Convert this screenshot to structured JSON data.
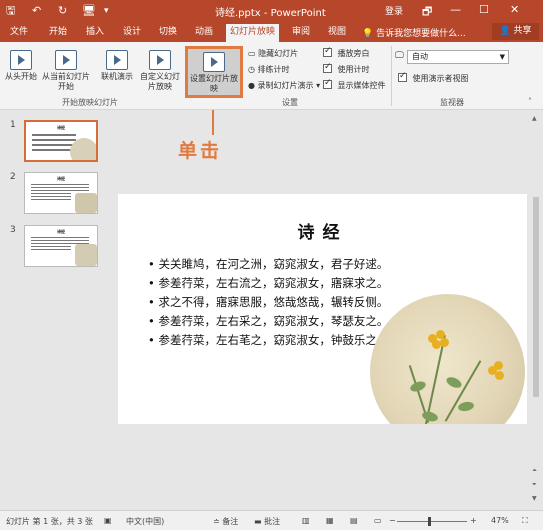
{
  "titlebar": {
    "title": "诗经.pptx - PowerPoint",
    "login": "登录",
    "save_glyph": "🖫",
    "undo_glyph": "↶",
    "redo_glyph": "↻",
    "slideshow_glyph": "🖥",
    "more_glyph": "▾",
    "restore_glyph": "🗗",
    "min_glyph": "—",
    "max_glyph": "☐",
    "close_glyph": "✕"
  },
  "tabs": {
    "items": [
      "文件",
      "开始",
      "插入",
      "设计",
      "切换",
      "动画",
      "幻灯片放映",
      "审阅",
      "视图"
    ],
    "active_index": 6,
    "tellme": "告诉我您想要做什么...",
    "share": "共享"
  },
  "ribbon": {
    "from_start": "从头开始",
    "from_current": "从当前幻灯片开始",
    "online": "联机演示",
    "custom": "自定义幻灯片放映",
    "setup": "设置幻灯片放映",
    "group_start": "开始放映幻灯片",
    "hide_slide": "隐藏幻灯片",
    "rehearse": "排练计时",
    "record": "录制幻灯片演示",
    "play_narration": "播放旁白",
    "use_timings": "使用计时",
    "show_media": "显示媒体控件",
    "group_setup": "设置",
    "monitor_value": "自动",
    "presenter_view": "使用演示者视图",
    "group_monitor": "监视器"
  },
  "annotation": {
    "label": "单击"
  },
  "thumbnails": [
    {
      "number": "1",
      "title": "诗经"
    },
    {
      "number": "2",
      "title": "诗经"
    },
    {
      "number": "3",
      "title": "诗经"
    }
  ],
  "slide": {
    "title": "诗经",
    "lines": [
      "• 关关雎鸠，在河之洲，窈窕淑女，君子好逑。",
      "• 参差荇菜，左右流之，窈窕淑女，寤寐求之。",
      "• 求之不得，寤寐思服，悠哉悠哉，辗转反侧。",
      "• 参差荇菜，左右采之，窈窕淑女，琴瑟友之。",
      "• 参差荇菜，左右芼之，窈窕淑女，钟鼓乐之。"
    ]
  },
  "status": {
    "slide_info": "幻灯片 第 1 张，共 3 张",
    "language": "中文(中国)",
    "notes": "备注",
    "comments": "批注",
    "zoom": "47%"
  },
  "colors": {
    "brand": "#b7472a",
    "highlight": "#e07a3f"
  }
}
